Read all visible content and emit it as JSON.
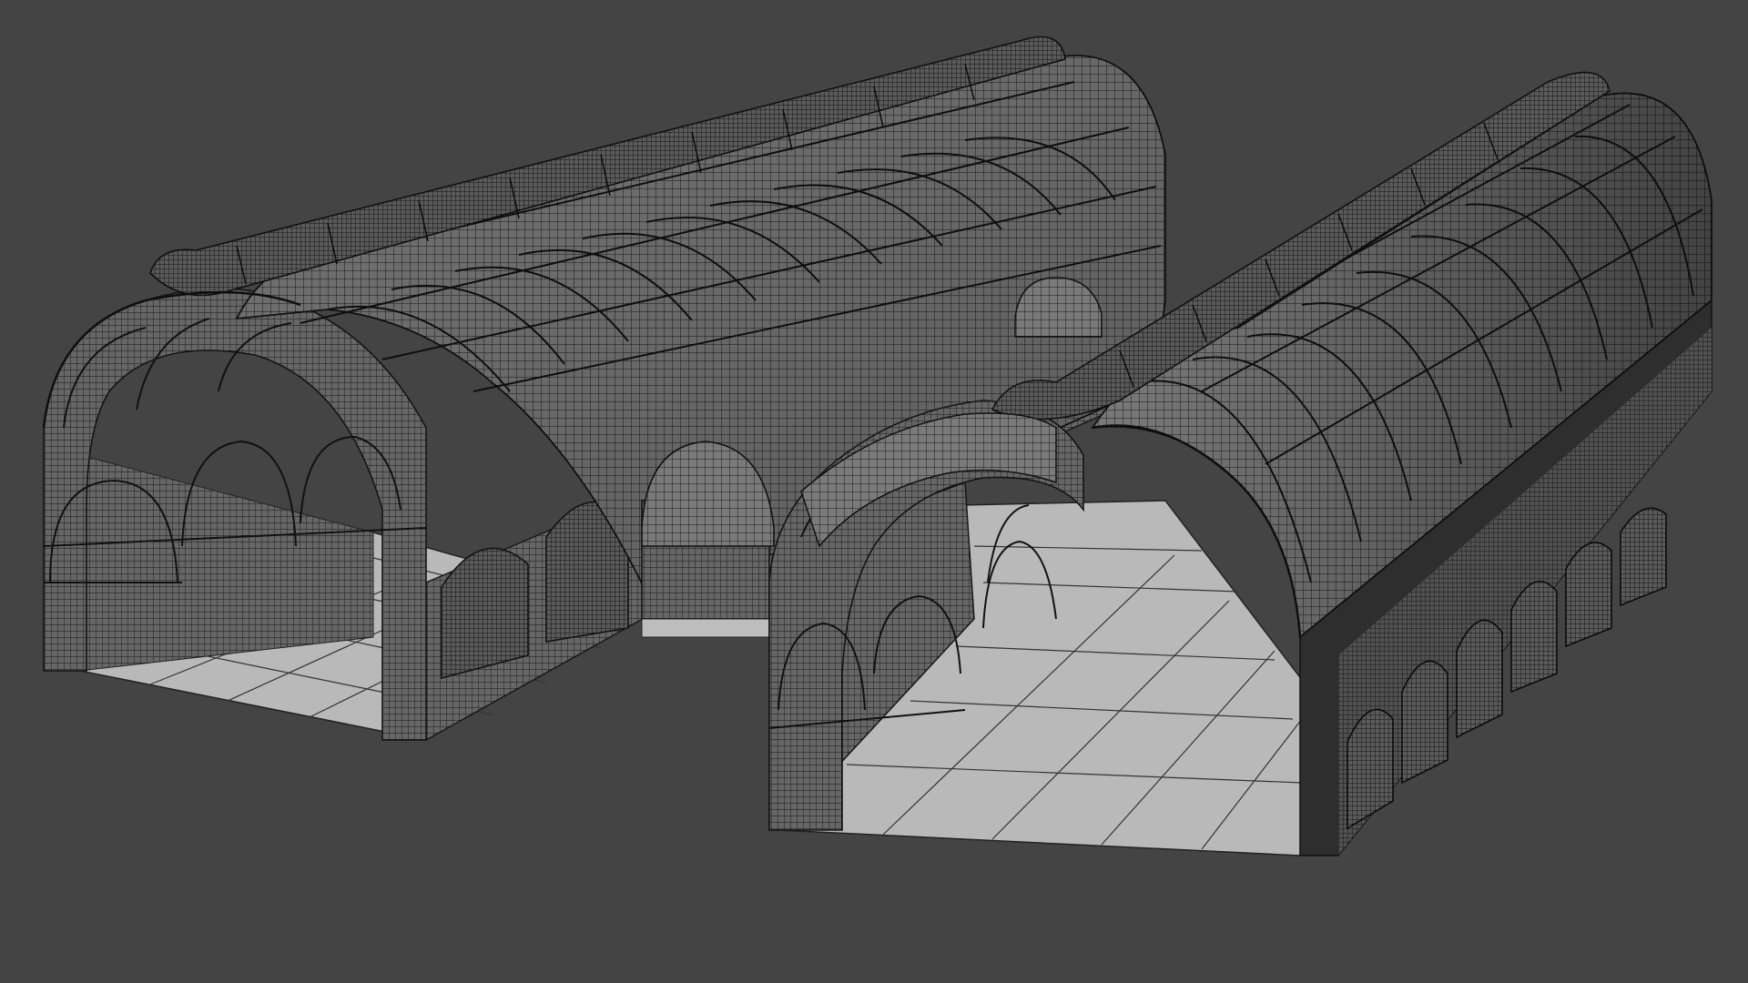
{
  "scene": {
    "subject": "wireframe-render",
    "background_color": "#444444",
    "floor_color": "#b8b8b8",
    "roof_fill": "#7c7c7c",
    "wire_color": "#151515"
  },
  "objects": [
    {
      "name": "left-hall"
    },
    {
      "name": "right-hall"
    },
    {
      "name": "connector-corridor"
    }
  ]
}
